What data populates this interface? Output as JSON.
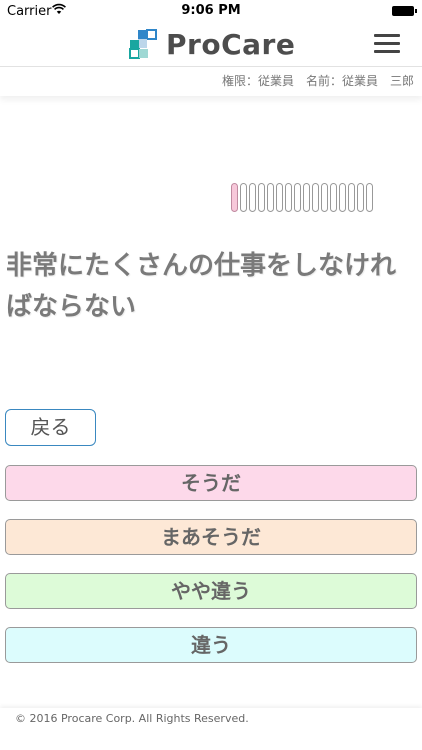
{
  "status_bar": {
    "carrier": "Carrier",
    "time": "9:06 PM"
  },
  "header": {
    "logo_text": "ProCare",
    "menu_icon": "hamburger-icon"
  },
  "info_bar": {
    "text": "権限：従業員　名前：従業員　三郎"
  },
  "progress": {
    "total": 16,
    "current": 1
  },
  "question": {
    "text": "非常にたくさんの仕事をしなければならない"
  },
  "back_label": "戻る",
  "answers": [
    {
      "label": "そうだ",
      "color": "#fdd9ea"
    },
    {
      "label": "まあそうだ",
      "color": "#fde8d6"
    },
    {
      "label": "やや違う",
      "color": "#ddfbd8"
    },
    {
      "label": "違う",
      "color": "#dcfcfd"
    }
  ],
  "footer": {
    "text": "© 2016 Procare Corp. All Rights Reserved."
  },
  "colors": {
    "logo_blue": "#2f86c9",
    "logo_teal": "#19a6a0",
    "accent_border": "#3a88c0"
  }
}
